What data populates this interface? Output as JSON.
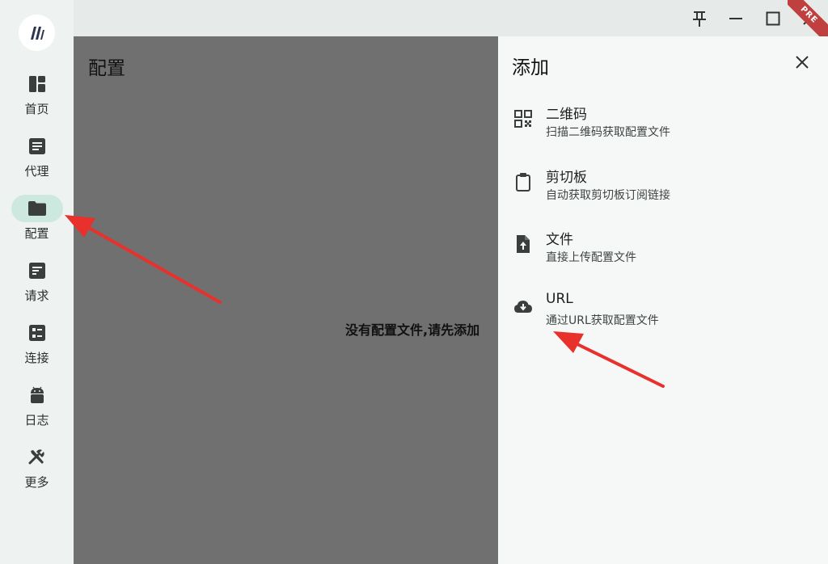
{
  "sidebar": {
    "items": [
      {
        "label": "首页",
        "icon": "dashboard-icon"
      },
      {
        "label": "代理",
        "icon": "article-icon"
      },
      {
        "label": "配置",
        "icon": "folder-icon",
        "active": true
      },
      {
        "label": "请求",
        "icon": "request-icon"
      },
      {
        "label": "连接",
        "icon": "connections-icon"
      },
      {
        "label": "日志",
        "icon": "android-icon"
      },
      {
        "label": "更多",
        "icon": "tools-icon"
      }
    ]
  },
  "titlebar": {
    "badge": "PRE"
  },
  "main": {
    "title": "配置",
    "empty_message": "没有配置文件,请先添加"
  },
  "drawer": {
    "title": "添加",
    "options": [
      {
        "title": "二维码",
        "description": "扫描二维码获取配置文件",
        "icon": "qr-code-icon"
      },
      {
        "title": "剪切板",
        "description": "自动获取剪切板订阅链接",
        "icon": "clipboard-icon"
      },
      {
        "title": "文件",
        "description": "直接上传配置文件",
        "icon": "file-upload-icon"
      },
      {
        "title": "URL",
        "description": "通过URL获取配置文件",
        "icon": "cloud-download-icon"
      }
    ]
  },
  "colors": {
    "accent": "#cde9df",
    "annotation": "#e8302c",
    "badge": "#c0403f"
  }
}
